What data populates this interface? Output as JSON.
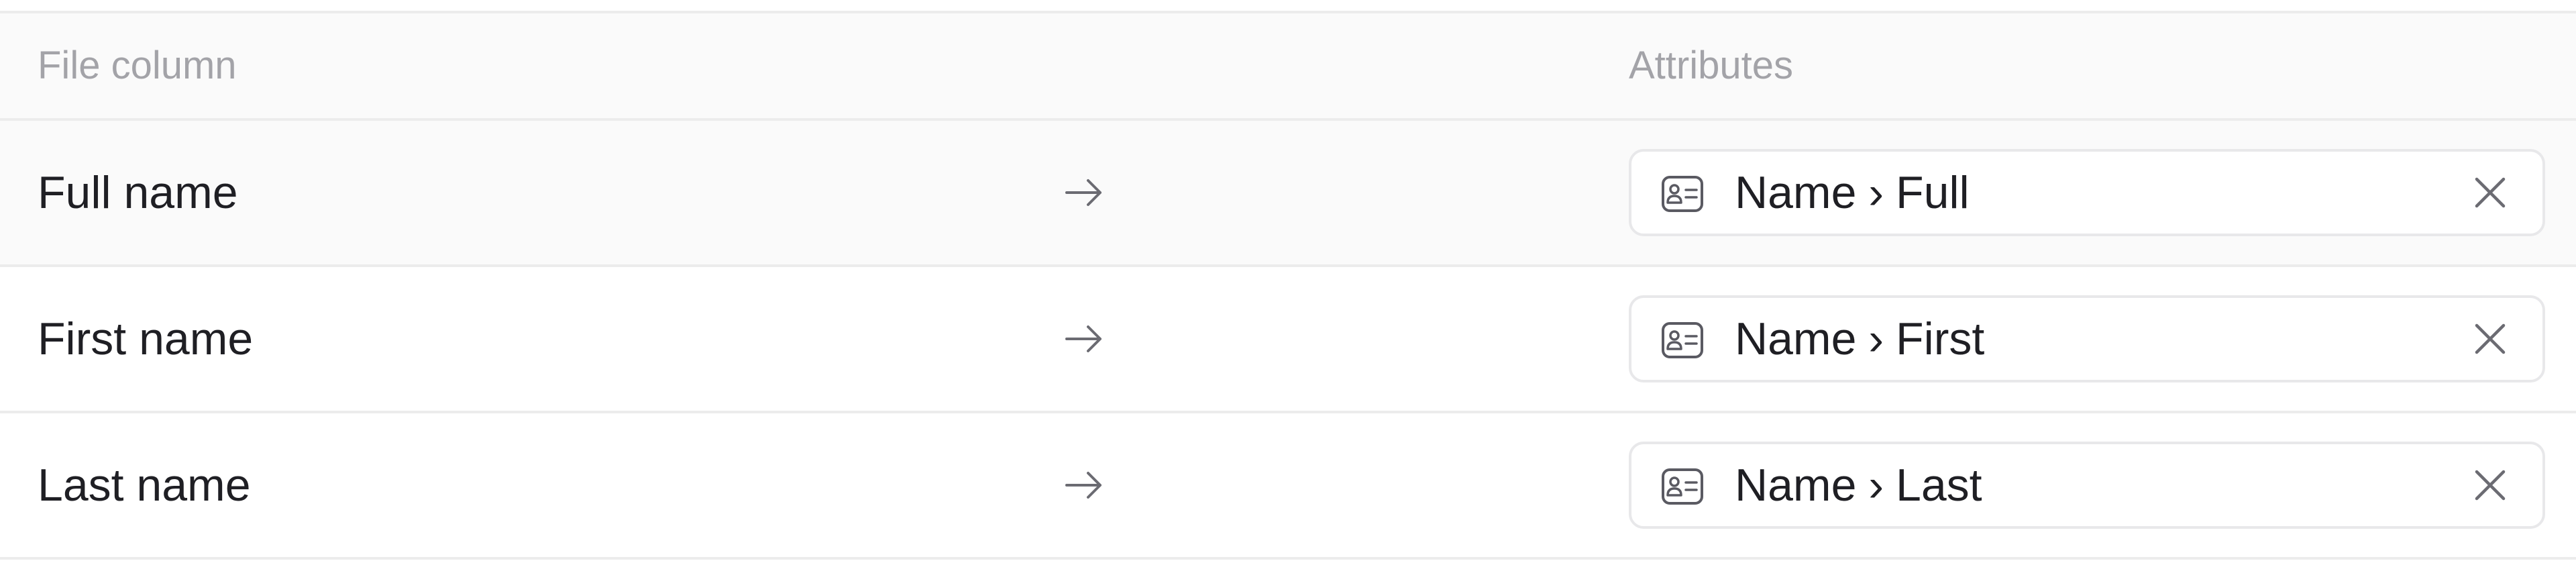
{
  "header": {
    "file_column_label": "File column",
    "attributes_label": "Attributes"
  },
  "separator_glyph": "›",
  "rows": [
    {
      "file_column": "Full name",
      "attribute_group": "Name",
      "attribute_field": "Full"
    },
    {
      "file_column": "First name",
      "attribute_group": "Name",
      "attribute_field": "First"
    },
    {
      "file_column": "Last name",
      "attribute_group": "Name",
      "attribute_field": "Last"
    }
  ],
  "icons": {
    "arrow": "arrow-right-icon",
    "attribute": "contact-card-icon",
    "remove": "close-icon"
  },
  "colors": {
    "header_bg": "#fafafa",
    "header_text": "#a3a3a8",
    "body_text": "#1f1f24",
    "border": "#ececec",
    "icon": "#6b6b72"
  }
}
